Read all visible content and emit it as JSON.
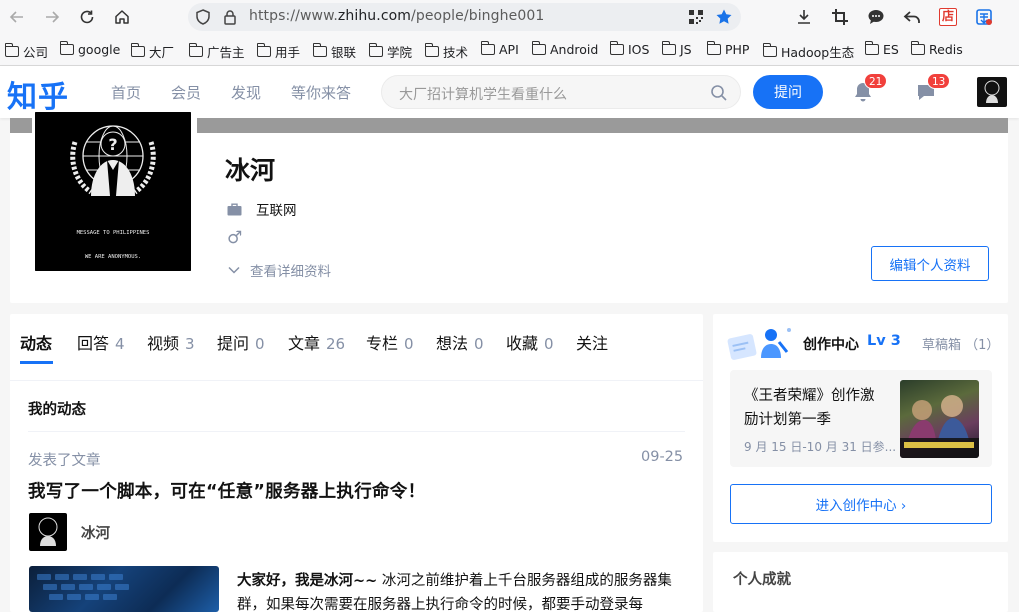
{
  "browser": {
    "url_prefix": "https://www.",
    "url_host": "zhihu.com",
    "url_path": "/people/binghe001",
    "toolbar_icons": [
      "back-arrow-icon",
      "forward-arrow-icon",
      "reload-icon",
      "home-icon",
      "shield-icon",
      "lock-icon",
      "qr-code-icon",
      "bookmark-star-icon",
      "download-icon",
      "crop-icon",
      "chat-bubble-icon",
      "undo-arrow-icon",
      "store-icon",
      "extension-icon"
    ],
    "store_icon_label": "店",
    "bookmarks": [
      "公司",
      "google",
      "大厂",
      "广告主",
      "用手",
      "银联",
      "学院",
      "技术",
      "API",
      "Android",
      "IOS",
      "JS",
      "PHP",
      "Hadoop生态",
      "ES",
      "Redis"
    ]
  },
  "header": {
    "logo": "知乎",
    "nav": [
      "首页",
      "会员",
      "发现",
      "等你来答"
    ],
    "search_placeholder": "大厂招计算机学生看重什么",
    "ask_label": "提问",
    "notifications_count": "21",
    "messages_count": "13"
  },
  "profile": {
    "name": "冰河",
    "industry": "互联网",
    "gender_symbol": "♂",
    "detail_link": "查看详细资料",
    "edit_label": "编辑个人资料",
    "avatar_text_top": "MESSAGE TO PHILIPPINES",
    "avatar_text_bottom": "WE ARE ANONYMOUS."
  },
  "tabs": [
    {
      "label": "动态",
      "count": ""
    },
    {
      "label": "回答",
      "count": "4"
    },
    {
      "label": "视频",
      "count": "3"
    },
    {
      "label": "提问",
      "count": "0"
    },
    {
      "label": "文章",
      "count": "26"
    },
    {
      "label": "专栏",
      "count": "0"
    },
    {
      "label": "想法",
      "count": "0"
    },
    {
      "label": "收藏",
      "count": "0"
    },
    {
      "label": "关注",
      "count": ""
    }
  ],
  "feed": {
    "section_title": "我的动态",
    "activity_type": "发表了文章",
    "date": "09-25",
    "article_title": "我写了一个脚本，可在“任意”服务器上执行命令！",
    "author": "冰河",
    "excerpt_bold": "大家好，我是冰河~~",
    "excerpt_rest": " 冰河之前维护着上千台服务器组成的服务器集群，如果每次需要在服务器上执行命令的时候，都要手动登录每"
  },
  "creator": {
    "title": "创作中心",
    "level": "Lv 3",
    "drafts": "草稿箱 （1）",
    "promo_title": "《王者荣耀》创作激励计划第一季",
    "promo_date": "9 月 15 日-10 月 31 日参...",
    "enter_label": "进入创作中心 ›"
  },
  "achievements": {
    "title": "个人成就"
  },
  "colors": {
    "brand": "#1772f6",
    "badge": "#f1403c",
    "muted": "#8590a6"
  }
}
